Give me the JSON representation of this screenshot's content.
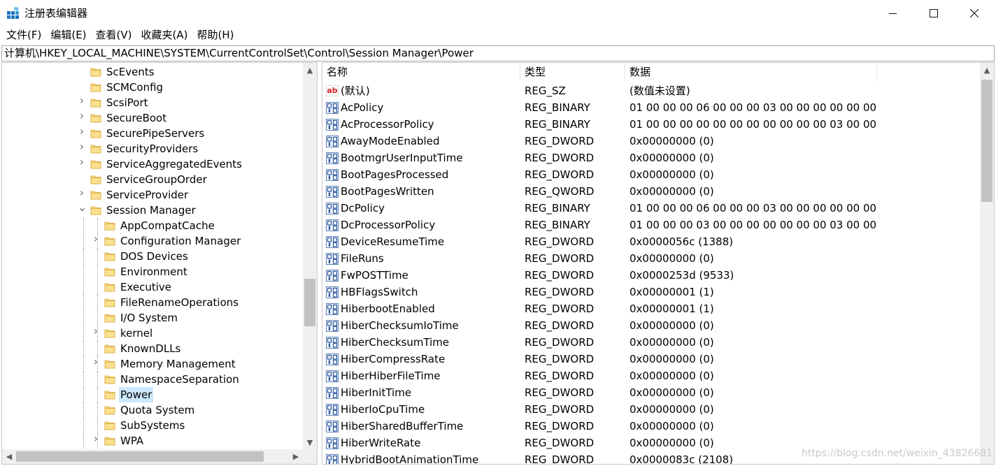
{
  "window": {
    "title": "注册表编辑器"
  },
  "menu": [
    {
      "label": "文件(F)"
    },
    {
      "label": "编辑(E)"
    },
    {
      "label": "查看(V)"
    },
    {
      "label": "收藏夹(A)"
    },
    {
      "label": "帮助(H)"
    }
  ],
  "address": {
    "path": "计算机\\HKEY_LOCAL_MACHINE\\SYSTEM\\CurrentControlSet\\Control\\Session Manager\\Power"
  },
  "tree": [
    {
      "label": "ScEvents",
      "depth": 0,
      "expander": "none"
    },
    {
      "label": "SCMConfig",
      "depth": 0,
      "expander": "none"
    },
    {
      "label": "ScsiPort",
      "depth": 0,
      "expander": "collapsed"
    },
    {
      "label": "SecureBoot",
      "depth": 0,
      "expander": "collapsed"
    },
    {
      "label": "SecurePipeServers",
      "depth": 0,
      "expander": "collapsed"
    },
    {
      "label": "SecurityProviders",
      "depth": 0,
      "expander": "collapsed"
    },
    {
      "label": "ServiceAggregatedEvents",
      "depth": 0,
      "expander": "collapsed"
    },
    {
      "label": "ServiceGroupOrder",
      "depth": 0,
      "expander": "none"
    },
    {
      "label": "ServiceProvider",
      "depth": 0,
      "expander": "collapsed"
    },
    {
      "label": "Session Manager",
      "depth": 0,
      "expander": "expanded"
    },
    {
      "label": "AppCompatCache",
      "depth": 1,
      "expander": "none"
    },
    {
      "label": "Configuration Manager",
      "depth": 1,
      "expander": "collapsed"
    },
    {
      "label": "DOS Devices",
      "depth": 1,
      "expander": "none"
    },
    {
      "label": "Environment",
      "depth": 1,
      "expander": "none"
    },
    {
      "label": "Executive",
      "depth": 1,
      "expander": "none"
    },
    {
      "label": "FileRenameOperations",
      "depth": 1,
      "expander": "none"
    },
    {
      "label": "I/O System",
      "depth": 1,
      "expander": "none"
    },
    {
      "label": "kernel",
      "depth": 1,
      "expander": "collapsed"
    },
    {
      "label": "KnownDLLs",
      "depth": 1,
      "expander": "none"
    },
    {
      "label": "Memory Management",
      "depth": 1,
      "expander": "collapsed"
    },
    {
      "label": "NamespaceSeparation",
      "depth": 1,
      "expander": "none"
    },
    {
      "label": "Power",
      "depth": 1,
      "expander": "none",
      "selected": true
    },
    {
      "label": "Quota System",
      "depth": 1,
      "expander": "none"
    },
    {
      "label": "SubSystems",
      "depth": 1,
      "expander": "none"
    },
    {
      "label": "WPA",
      "depth": 1,
      "expander": "collapsed"
    }
  ],
  "list": {
    "headers": {
      "name": "名称",
      "type": "类型",
      "data": "数据"
    },
    "rows": [
      {
        "name": "(默认)",
        "type": "REG_SZ",
        "data": "(数值未设置)",
        "icon": "ab-string-icon"
      },
      {
        "name": "AcPolicy",
        "type": "REG_BINARY",
        "data": "01 00 00 00 06 00 00 00 03 00 00 00 00 00 00 ...",
        "icon": "binary-value-icon"
      },
      {
        "name": "AcProcessorPolicy",
        "type": "REG_BINARY",
        "data": "01 00 00 00 00 00 00 00 00 00 00 00 03 00 00 ...",
        "icon": "binary-value-icon"
      },
      {
        "name": "AwayModeEnabled",
        "type": "REG_DWORD",
        "data": "0x00000000 (0)",
        "icon": "binary-value-icon"
      },
      {
        "name": "BootmgrUserInputTime",
        "type": "REG_DWORD",
        "data": "0x00000000 (0)",
        "icon": "binary-value-icon"
      },
      {
        "name": "BootPagesProcessed",
        "type": "REG_DWORD",
        "data": "0x00000000 (0)",
        "icon": "binary-value-icon"
      },
      {
        "name": "BootPagesWritten",
        "type": "REG_QWORD",
        "data": "0x00000000 (0)",
        "icon": "binary-value-icon"
      },
      {
        "name": "DcPolicy",
        "type": "REG_BINARY",
        "data": "01 00 00 00 06 00 00 00 03 00 00 00 00 00 00 ...",
        "icon": "binary-value-icon"
      },
      {
        "name": "DcProcessorPolicy",
        "type": "REG_BINARY",
        "data": "01 00 00 00 03 00 00 00 00 00 00 00 03 00 00 ...",
        "icon": "binary-value-icon"
      },
      {
        "name": "DeviceResumeTime",
        "type": "REG_DWORD",
        "data": "0x0000056c (1388)",
        "icon": "binary-value-icon"
      },
      {
        "name": "FileRuns",
        "type": "REG_DWORD",
        "data": "0x00000000 (0)",
        "icon": "binary-value-icon"
      },
      {
        "name": "FwPOSTTime",
        "type": "REG_DWORD",
        "data": "0x0000253d (9533)",
        "icon": "binary-value-icon"
      },
      {
        "name": "HBFlagsSwitch",
        "type": "REG_DWORD",
        "data": "0x00000001 (1)",
        "icon": "binary-value-icon"
      },
      {
        "name": "HiberbootEnabled",
        "type": "REG_DWORD",
        "data": "0x00000001 (1)",
        "icon": "binary-value-icon"
      },
      {
        "name": "HiberChecksumIoTime",
        "type": "REG_DWORD",
        "data": "0x00000000 (0)",
        "icon": "binary-value-icon"
      },
      {
        "name": "HiberChecksumTime",
        "type": "REG_DWORD",
        "data": "0x00000000 (0)",
        "icon": "binary-value-icon"
      },
      {
        "name": "HiberCompressRate",
        "type": "REG_DWORD",
        "data": "0x00000000 (0)",
        "icon": "binary-value-icon"
      },
      {
        "name": "HiberHiberFileTime",
        "type": "REG_DWORD",
        "data": "0x00000000 (0)",
        "icon": "binary-value-icon"
      },
      {
        "name": "HiberInitTime",
        "type": "REG_DWORD",
        "data": "0x00000000 (0)",
        "icon": "binary-value-icon"
      },
      {
        "name": "HiberIoCpuTime",
        "type": "REG_DWORD",
        "data": "0x00000000 (0)",
        "icon": "binary-value-icon"
      },
      {
        "name": "HiberSharedBufferTime",
        "type": "REG_DWORD",
        "data": "0x00000000 (0)",
        "icon": "binary-value-icon"
      },
      {
        "name": "HiberWriteRate",
        "type": "REG_DWORD",
        "data": "0x00000000 (0)",
        "icon": "binary-value-icon"
      },
      {
        "name": "HybridBootAnimationTime",
        "type": "REG_DWORD",
        "data": "0x0000083c (2108)",
        "icon": "binary-value-icon"
      }
    ]
  },
  "watermark": "https://blog.csdn.net/weixin_43826681",
  "colors": {
    "selection": "#cce8ff",
    "folder": "#f8d775",
    "scrollbar": "#f0f0f0",
    "thumb": "#c2c2c2"
  }
}
